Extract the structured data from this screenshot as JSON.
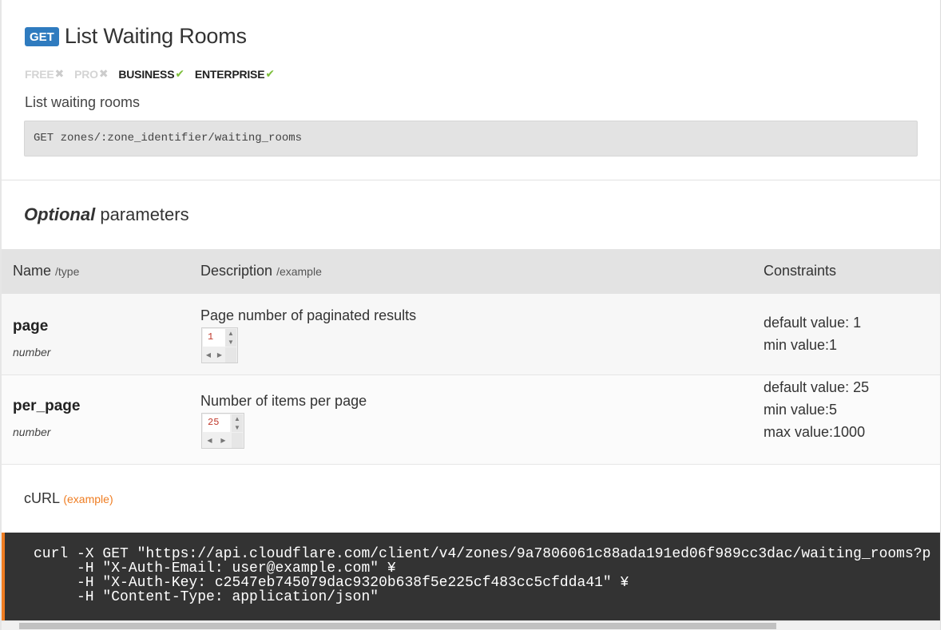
{
  "endpoint": {
    "method": "GET",
    "title": "List Waiting Rooms",
    "summary": "List waiting rooms",
    "route": "GET zones/:zone_identifier/waiting_rooms",
    "plans": [
      {
        "label": "FREE",
        "available": false,
        "mark": "✖"
      },
      {
        "label": "PRO",
        "available": false,
        "mark": "✖"
      },
      {
        "label": "BUSINESS",
        "available": true,
        "mark": "✔"
      },
      {
        "label": "ENTERPRISE",
        "available": true,
        "mark": "✔"
      }
    ]
  },
  "params": {
    "heading_em": "Optional",
    "heading_rest": " parameters",
    "columns": {
      "name": "Name",
      "name_sub": "/type",
      "description": "Description",
      "description_sub": "/example",
      "constraints": "Constraints"
    },
    "rows": [
      {
        "name": "page",
        "type": "number",
        "description": "Page number of paginated results",
        "example": "1",
        "constraints": [
          "default value: 1",
          "min value:1"
        ]
      },
      {
        "name": "per_page",
        "type": "number",
        "description": "Number of items per page",
        "example": "25",
        "constraints": [
          "default value: 25",
          "min value:5",
          "max value:1000"
        ]
      }
    ]
  },
  "curl": {
    "heading": "cURL",
    "example_label": "(example)",
    "lines": [
      "curl -X GET \"https://api.cloudflare.com/client/v4/zones/9a7806061c88ada191ed06f989cc3dac/waiting_rooms?p",
      "     -H \"X-Auth-Email: user@example.com\" ¥",
      "     -H \"X-Auth-Key: c2547eb745079dac9320b638f5e225cf483cc5cfdda41\" ¥",
      "     -H \"Content-Type: application/json\""
    ]
  },
  "icons": {
    "spin_up": "▲",
    "spin_down": "▼",
    "scroll_left": "◀",
    "scroll_right": "▶"
  },
  "colors": {
    "method_badge": "#2f7bbf",
    "available": "#7dbf3b",
    "unavailable": "#cccccc",
    "accent": "#ef7d22",
    "code_bg": "#333333"
  }
}
